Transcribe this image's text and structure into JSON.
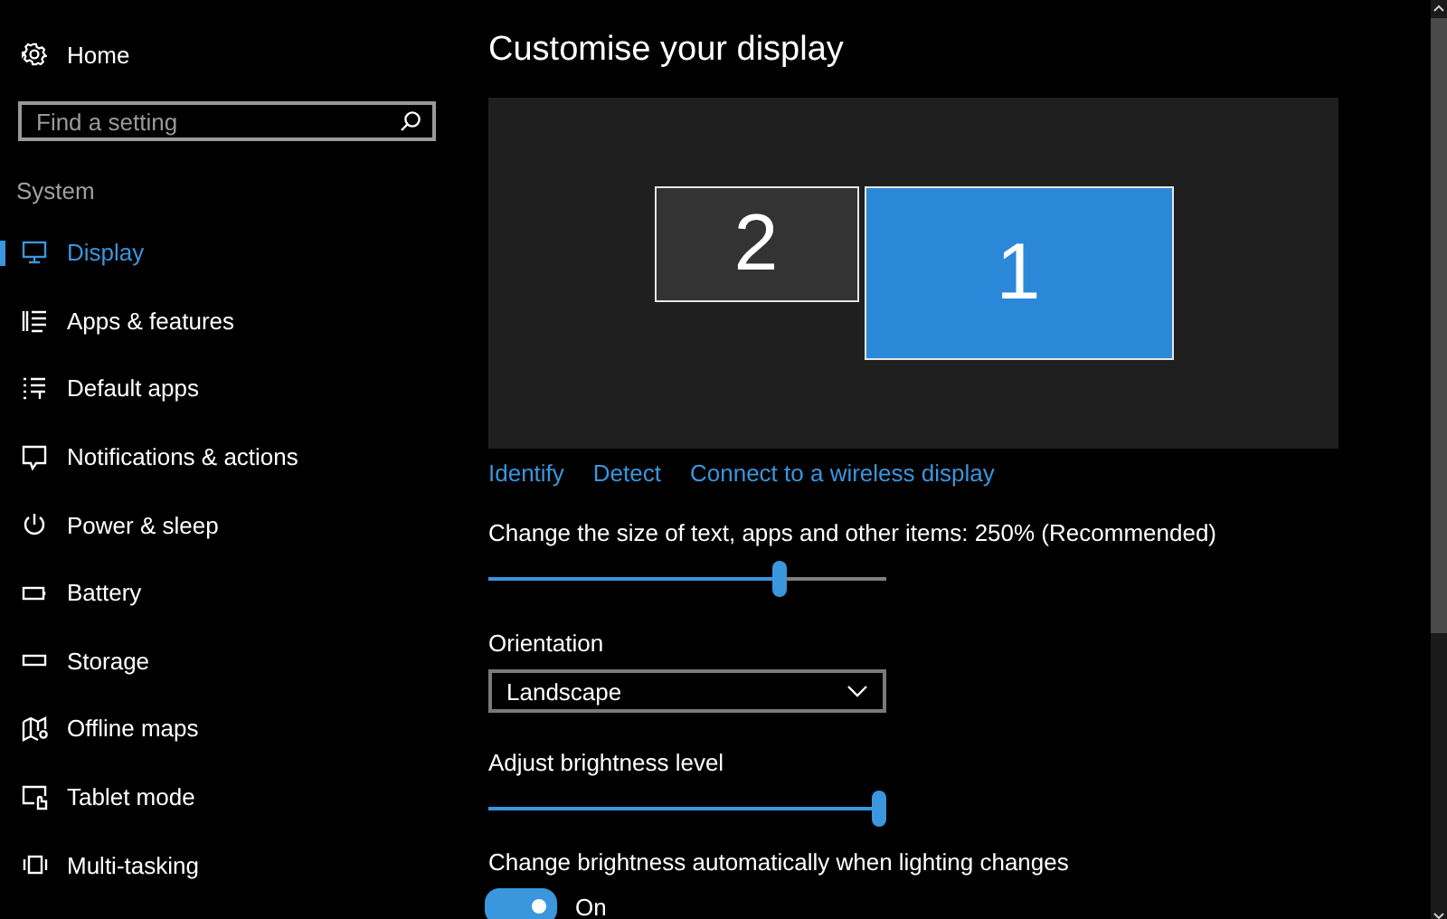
{
  "sidebar": {
    "home": {
      "label": "Home"
    },
    "search": {
      "placeholder": "Find a setting"
    },
    "section": "System",
    "items": [
      {
        "label": "Display",
        "selected": true
      },
      {
        "label": "Apps & features",
        "selected": false
      },
      {
        "label": "Default apps",
        "selected": false
      },
      {
        "label": "Notifications & actions",
        "selected": false
      },
      {
        "label": "Power & sleep",
        "selected": false
      },
      {
        "label": "Battery",
        "selected": false
      },
      {
        "label": "Storage",
        "selected": false
      },
      {
        "label": "Offline maps",
        "selected": false
      },
      {
        "label": "Tablet mode",
        "selected": false
      },
      {
        "label": "Multi-tasking",
        "selected": false
      }
    ]
  },
  "main": {
    "title": "Customise your display",
    "monitors": [
      {
        "number": "2",
        "selected": false
      },
      {
        "number": "1",
        "selected": true
      }
    ],
    "links": [
      "Identify",
      "Detect",
      "Connect to a wireless display"
    ],
    "scale": {
      "label": "Change the size of text, apps and other items: 250% (Recommended)",
      "level": 0.74
    },
    "orientation": {
      "label": "Orientation",
      "value": "Landscape"
    },
    "brightness": {
      "label": "Adjust brightness level",
      "level": 1.0
    },
    "auto_brightness": {
      "label": "Change brightness automatically when lighting changes",
      "on": true,
      "state_text": "On"
    }
  }
}
